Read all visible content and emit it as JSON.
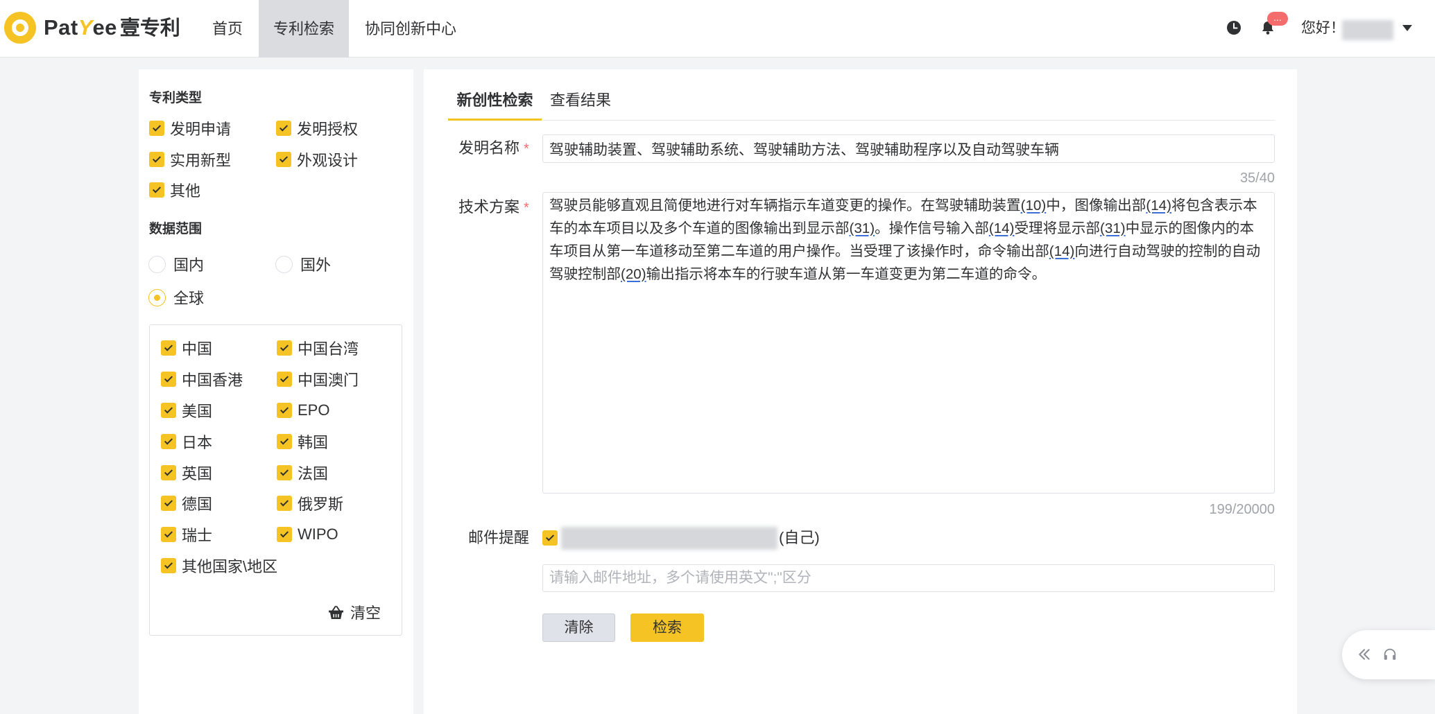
{
  "logo": {
    "brand_part1": "Pat",
    "brand_part2": "Y",
    "brand_part3": "ee",
    "brand_cn": "壹专利"
  },
  "nav": {
    "items": [
      {
        "label": "首页",
        "active": false
      },
      {
        "label": "专利检索",
        "active": true
      },
      {
        "label": "协同创新中心",
        "active": false
      }
    ]
  },
  "header": {
    "notification_badge": "...",
    "greeting": "您好！",
    "icons": {
      "history": "clock-icon",
      "notifications": "bell-icon",
      "user_menu": "caret-down-icon"
    }
  },
  "filters": {
    "patent_type": {
      "title": "专利类型",
      "options": [
        {
          "label": "发明申请",
          "checked": true
        },
        {
          "label": "发明授权",
          "checked": true
        },
        {
          "label": "实用新型",
          "checked": true
        },
        {
          "label": "外观设计",
          "checked": true
        },
        {
          "label": "其他",
          "checked": true
        }
      ]
    },
    "data_scope": {
      "title": "数据范围",
      "options": [
        {
          "label": "国内",
          "selected": false
        },
        {
          "label": "国外",
          "selected": false
        },
        {
          "label": "全球",
          "selected": true
        }
      ]
    },
    "countries": [
      {
        "label": "中国",
        "checked": true
      },
      {
        "label": "中国台湾",
        "checked": true
      },
      {
        "label": "中国香港",
        "checked": true
      },
      {
        "label": "中国澳门",
        "checked": true
      },
      {
        "label": "美国",
        "checked": true
      },
      {
        "label": "EPO",
        "checked": true
      },
      {
        "label": "日本",
        "checked": true
      },
      {
        "label": "韩国",
        "checked": true
      },
      {
        "label": "英国",
        "checked": true
      },
      {
        "label": "法国",
        "checked": true
      },
      {
        "label": "德国",
        "checked": true
      },
      {
        "label": "俄罗斯",
        "checked": true
      },
      {
        "label": "瑞士",
        "checked": true
      },
      {
        "label": "WIPO",
        "checked": true
      },
      {
        "label": "其他国家\\地区",
        "checked": true
      }
    ],
    "clear_label": "清空",
    "clear_icon": "basket-icon"
  },
  "search": {
    "tabs": [
      {
        "label": "新创性检索",
        "active": true
      },
      {
        "label": "查看结果",
        "active": false
      }
    ],
    "title_field": {
      "label": "发明名称",
      "required_mark": "*",
      "value": "驾驶辅助装置、驾驶辅助系统、驾驶辅助方法、驾驶辅助程序以及自动驾驶车辆",
      "counter": "35/40"
    },
    "scheme_field": {
      "label": "技术方案",
      "required_mark": "*",
      "segments": [
        {
          "text": "驾驶员能够直观且简便地进行对车辆指示车道变更的操作。在驾驶辅助装置",
          "underlined": false
        },
        {
          "text": "(10)",
          "underlined": true
        },
        {
          "text": "中，图像输出部",
          "underlined": false
        },
        {
          "text": "(14)",
          "underlined": true
        },
        {
          "text": "将包含表示本车的本车项目以及多个车道的图像输出到显示部",
          "underlined": false
        },
        {
          "text": "(31)",
          "underlined": true
        },
        {
          "text": "。操作信号输入部",
          "underlined": false
        },
        {
          "text": "(14)",
          "underlined": true
        },
        {
          "text": "受理将显示部",
          "underlined": false
        },
        {
          "text": "(31)",
          "underlined": true
        },
        {
          "text": "中显示的图像内的本车项目从第一车道移动至第二车道的用户操作。当受理了该操作时，命令输出部",
          "underlined": false
        },
        {
          "text": "(14)",
          "underlined": true
        },
        {
          "text": "向进行自动驾驶的控制的自动驾驶控制部",
          "underlined": false
        },
        {
          "text": "(20)",
          "underlined": true
        },
        {
          "text": "输出指示将本车的行驶车道从第一车道变更为第二车道的命令。",
          "underlined": false
        }
      ],
      "counter": "199/20000"
    },
    "email_reminder": {
      "label": "邮件提醒",
      "checked": true,
      "self_suffix": "(自己)",
      "placeholder": "请输入邮件地址，多个请使用英文\";\"区分"
    },
    "buttons": {
      "clear": "清除",
      "search": "检索"
    }
  },
  "support_widget": {
    "icons": [
      "double-chevron-left-icon",
      "headset-icon"
    ]
  },
  "colors": {
    "accent": "#f6c324",
    "active_nav_bg": "#dadcdf",
    "required": "#f56c6c",
    "badge": "#f56c6c",
    "page_bg": "#f3f4f6",
    "reference_underline": "#3b6fd6"
  }
}
